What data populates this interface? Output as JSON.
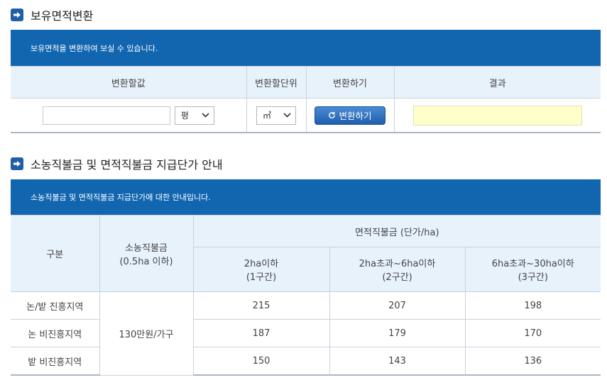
{
  "section1": {
    "title": "보유면적변환",
    "banner": "보유면적을 변환하여 보실 수 있습니다.",
    "headers": [
      "변환할값",
      "변환할단위",
      "변환하기",
      "결과"
    ],
    "input_value": "",
    "from_unit": "평",
    "to_unit": "㎡",
    "convert_button": "변환하기",
    "result": ""
  },
  "section2": {
    "title": "소농직불금 및 면적직불금 지급단가 안내",
    "banner": "소농직불금 및 면적직불금 지급단가에 대한 안내입니다.",
    "head": {
      "category": "구분",
      "small_farm_line1": "소농직불금",
      "small_farm_line2": "(0.5ha 이하)",
      "area_group": "면적직불금 (단가/ha)",
      "tiers": [
        {
          "line1": "2ha이하",
          "line2": "(1구간)"
        },
        {
          "line1": "2ha초과~6ha이하",
          "line2": "(2구간)"
        },
        {
          "line1": "6ha초과~30ha이하",
          "line2": "(3구간)"
        }
      ]
    },
    "small_farm_value": "130만원/가구",
    "rows": [
      {
        "label": "논/밭 진흥지역",
        "values": [
          "215",
          "207",
          "198"
        ]
      },
      {
        "label": "논 비진흥지역",
        "values": [
          "187",
          "179",
          "170"
        ]
      },
      {
        "label": "밭 비진흥지역",
        "values": [
          "150",
          "143",
          "136"
        ]
      }
    ]
  }
}
